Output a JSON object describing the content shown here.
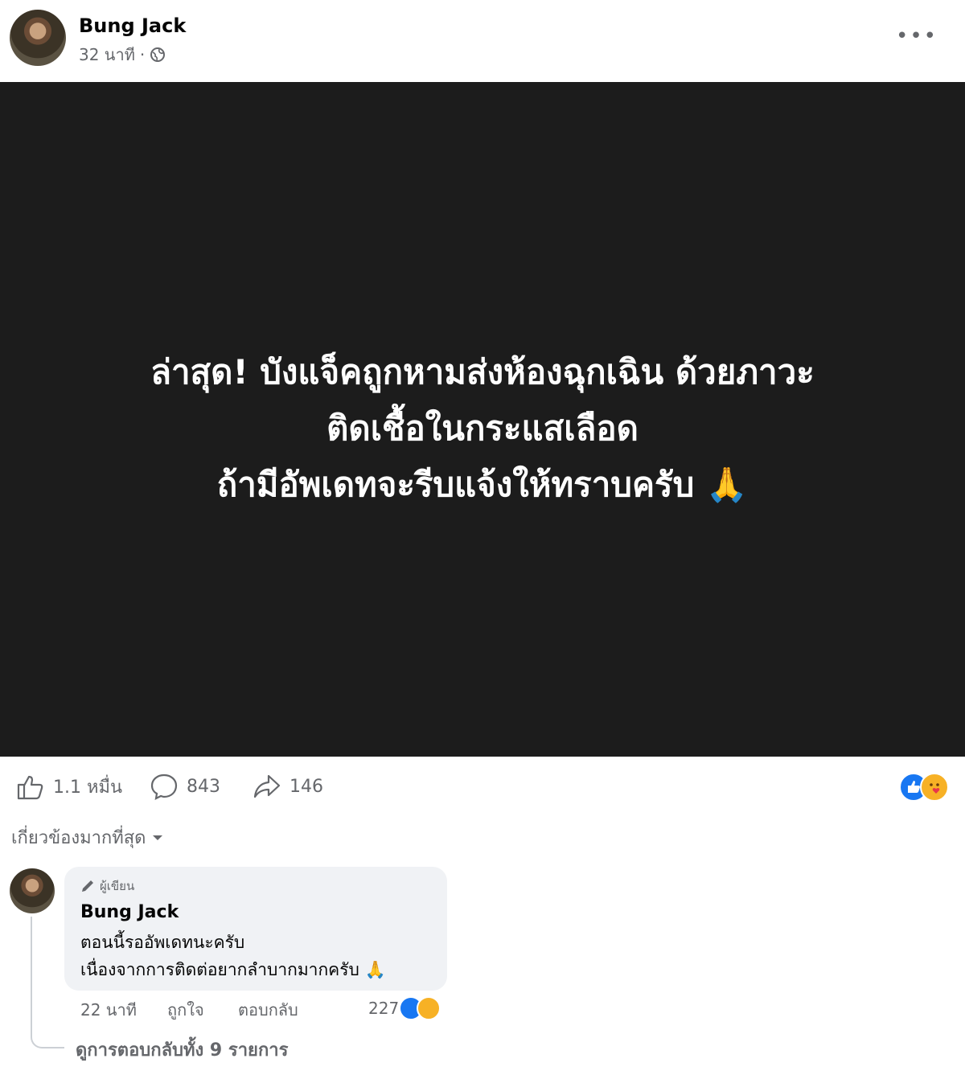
{
  "post": {
    "author": "Bung Jack",
    "time": "32 นาที",
    "separator": "·",
    "more_icon": "more-horizontal-icon",
    "privacy_icon": "globe-icon",
    "image_text": [
      "ล่าสุด! บังแจ็คถูกหามส่งห้องฉุกเฉิน ด้วยภาวะ",
      "ติดเชื้อในกระแสเลือด",
      "ถ้ามีอัพเดทจะรีบแจ้งให้ทราบครับ 🙏"
    ]
  },
  "stats": {
    "likes": "1.1 หมื่น",
    "comments": "843",
    "shares": "146",
    "reaction_icons": [
      "like-reaction-icon",
      "care-reaction-icon"
    ]
  },
  "comments_section": {
    "sort_label": "เกี่ยวข้องมากที่สุด",
    "comment": {
      "badge": "ผู้เขียน",
      "author": "Bung Jack",
      "lines": [
        "ตอนนี้รออัพเดทนะครับ",
        "เนื่องจากการติดต่อยากลำบากมากครับ 🙏"
      ],
      "time": "22 นาที",
      "like_label": "ถูกใจ",
      "reply_label": "ตอบกลับ",
      "reaction_count": "227"
    },
    "view_replies": "ดูการตอบกลับทั้ง 9 รายการ"
  },
  "colors": {
    "like_blue": "#1877f2",
    "image_bg": "#1c1c1c",
    "muted_text": "#65676b",
    "bubble_bg": "#f0f2f5"
  }
}
